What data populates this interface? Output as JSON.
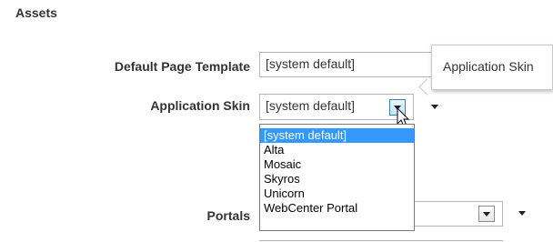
{
  "section": {
    "title": "Assets"
  },
  "fields": {
    "default_page_template": {
      "label": "Default Page Template",
      "value": "[system default]"
    },
    "application_skin": {
      "label": "Application Skin",
      "value": "[system default]"
    },
    "portals": {
      "label": "Portals",
      "value": ""
    }
  },
  "tooltip": {
    "text": "Application Skin"
  },
  "skin_options": [
    "[system default]",
    "Alta",
    "Mosaic",
    "Skyros",
    "Unicorn",
    "WebCenter Portal"
  ],
  "selected_option_index": 0,
  "icons": {
    "dropdown": "chevron-down-icon",
    "cursor": "mouse-pointer-icon"
  },
  "colors": {
    "selection": "#3399ff",
    "text": "#333333"
  }
}
